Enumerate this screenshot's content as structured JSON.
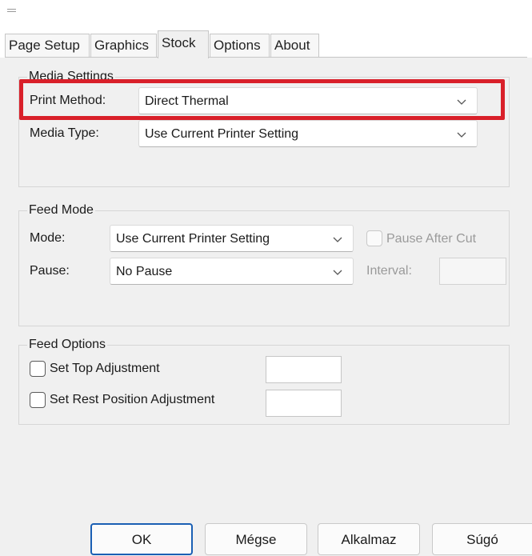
{
  "tabs": [
    {
      "label": "Page Setup",
      "active": false
    },
    {
      "label": "Graphics",
      "active": false
    },
    {
      "label": "Stock",
      "active": true
    },
    {
      "label": "Options",
      "active": false
    },
    {
      "label": "About",
      "active": false
    }
  ],
  "media_settings": {
    "title": "Media Settings",
    "print_method_label": "Print Method:",
    "print_method_value": "Direct Thermal",
    "media_type_label": "Media Type:",
    "media_type_value": "Use Current Printer Setting"
  },
  "feed_mode": {
    "title": "Feed Mode",
    "mode_label": "Mode:",
    "mode_value": "Use Current Printer Setting",
    "pause_after_cut_label": "Pause After Cut",
    "pause_label": "Pause:",
    "pause_value": "No Pause",
    "interval_label": "Interval:"
  },
  "feed_options": {
    "title": "Feed Options",
    "set_top_adjustment_label": "Set Top Adjustment",
    "set_rest_position_label": "Set Rest Position Adjustment"
  },
  "buttons": {
    "ok": "OK",
    "cancel": "Mégse",
    "apply": "Alkalmaz",
    "help": "Súgó"
  },
  "colors": {
    "highlight": "#d9202a",
    "default_button_border": "#1a5fb4"
  }
}
